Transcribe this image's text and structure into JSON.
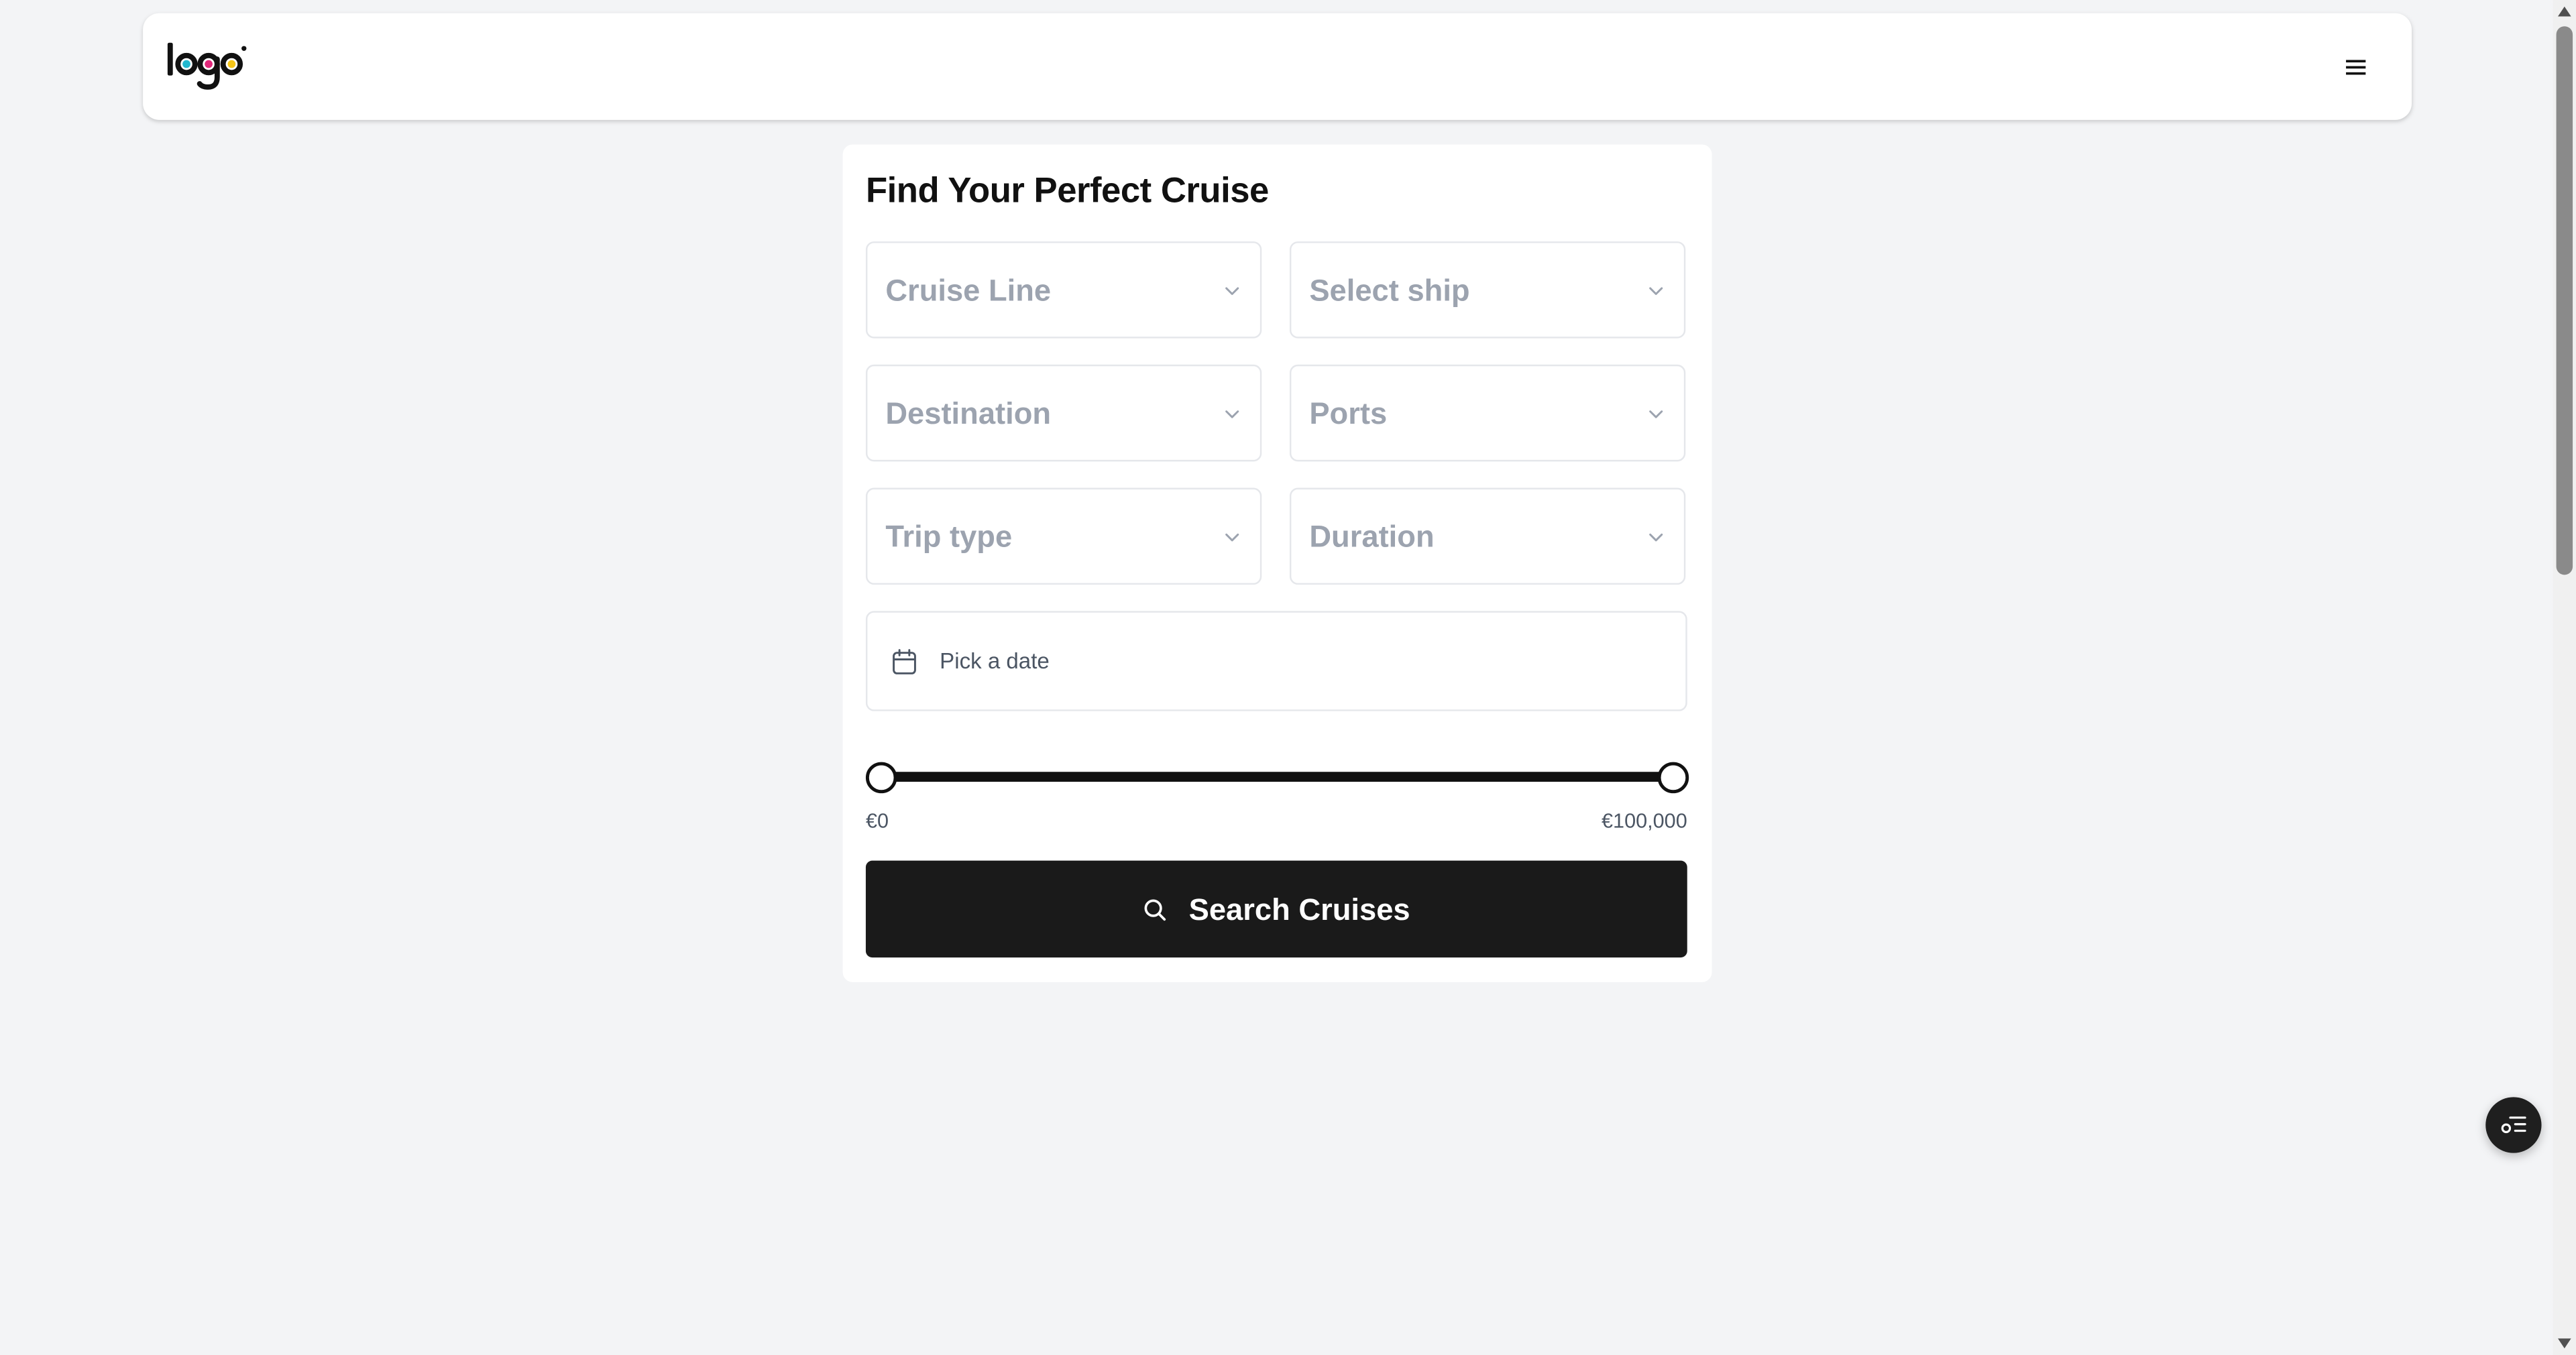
{
  "header": {
    "menu_icon": "hamburger-menu-icon"
  },
  "search_form": {
    "title": "Find Your Perfect Cruise",
    "cruise_line_placeholder": "Cruise Line",
    "ship_placeholder": "Select ship",
    "destination_placeholder": "Destination",
    "ports_placeholder": "Ports",
    "trip_type_placeholder": "Trip type",
    "duration_placeholder": "Duration",
    "date_placeholder": "Pick a date",
    "price_min_label": "€0",
    "price_max_label": "€100,000",
    "price_range": {
      "min": 0,
      "max": 100000,
      "selected_min": 0,
      "selected_max": 100000
    },
    "search_button_label": "Search Cruises"
  },
  "colors": {
    "logo_cyan": "#22b8cf",
    "logo_magenta": "#e0287a",
    "logo_yellow": "#f5c518",
    "button_dark": "#1a1a1a",
    "placeholder_gray": "#9ca3af"
  },
  "icons": {
    "dropdown": "chevron-down-icon",
    "date": "calendar-icon",
    "search": "search-icon",
    "fab": "list-settings-icon"
  }
}
